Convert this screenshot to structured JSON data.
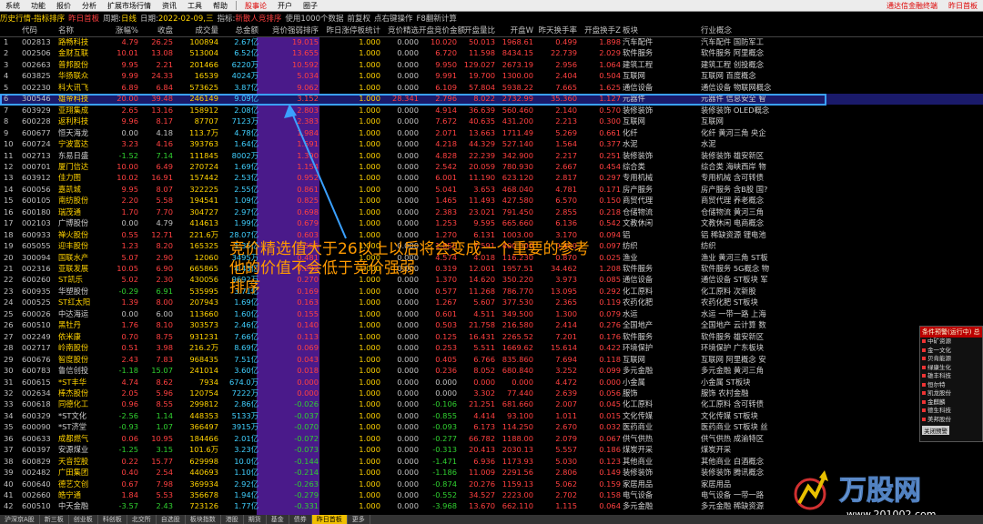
{
  "menu": {
    "items": [
      "系统",
      "功能",
      "报价",
      "分析",
      "扩展市场行情",
      "资讯",
      "工具",
      "帮助"
    ],
    "mid_items": [
      "股事论",
      "开户",
      "圈子"
    ],
    "right_items": [
      "通达信金融终端",
      "昨日首板"
    ]
  },
  "titlebar": {
    "tag": "历史行情-指标排序",
    "block": "昨日首板",
    "period_label": "周期:",
    "period": "日线",
    "date_label": "日期:",
    "date": "2022-02-09,三",
    "indicator_label": "指标:",
    "indicator": "新散人竞排序",
    "use_label": "使用1000个数据",
    "prev_label": "前复权",
    "hint": "点右键操作",
    "f8": "F8翻新计算"
  },
  "columns": [
    "",
    "代码",
    "名称",
    "涨幅%",
    "收盘",
    "成交量",
    "总金额",
    "竞价强弱排序",
    "昨日涨停板统计",
    "竞价精选",
    "开盘竞价金额",
    "开盘量比",
    "开盘W",
    "昨天换手率",
    "开盘换手Z",
    "板块",
    "行业概念"
  ],
  "rows": [
    [
      "1",
      "002813",
      "路畅科技",
      "4.79",
      "26.25",
      "100894",
      "2.67亿",
      "19.015",
      "1.000",
      "0.000",
      "10.020",
      "50.013",
      "1968.61",
      "0.499",
      "1.898",
      "汽车配件",
      "汽车配件  国防军工"
    ],
    [
      "2",
      "002506",
      "金财互联",
      "10.01",
      "13.08",
      "513004",
      "6.52亿",
      "13.655",
      "1.000",
      "0.000",
      "6.720",
      "11.598",
      "8434.15",
      "22.739",
      "2.029",
      "软件服务",
      "软件服务  阿里概念"
    ],
    [
      "3",
      "002663",
      "普邦股份",
      "9.95",
      "2.21",
      "201466",
      "6220万",
      "10.592",
      "1.000",
      "0.000",
      "9.950",
      "129.027",
      "2673.19",
      "2.956",
      "1.064",
      "建筑工程",
      "建筑工程  创投概念"
    ],
    [
      "4",
      "603825",
      "华扬联众",
      "9.99",
      "24.33",
      "16539",
      "4024万",
      "5.034",
      "1.000",
      "0.000",
      "9.991",
      "19.700",
      "1300.00",
      "2.404",
      "0.504",
      "互联网",
      "互联网  百度概念"
    ],
    [
      "5",
      "002230",
      "科大讯飞",
      "6.89",
      "6.84",
      "573625",
      "3.87亿",
      "9.062",
      "1.000",
      "0.000",
      "6.109",
      "57.804",
      "5938.22",
      "7.665",
      "1.625",
      "通信设备",
      "通信设备  物联网概念"
    ],
    [
      "6",
      "300546",
      "雄帝科技",
      "20.00",
      "39.48",
      "246149",
      "9.09亿",
      "3.152",
      "1.000",
      "28.341",
      "2.796",
      "8.022",
      "2732.99",
      "35.360",
      "1.127",
      "元器件",
      "元器件  信息安全 智"
    ],
    [
      "7",
      "603929",
      "亚翔集成",
      "2.65",
      "13.16",
      "158912",
      "2.08亿",
      "2.803",
      "1.000",
      "0.000",
      "4.914",
      "36.639",
      "560.460",
      "2.140",
      "0.570",
      "装修装饰",
      "装修装饰  OLED概念"
    ],
    [
      "8",
      "600228",
      "返利科技",
      "9.96",
      "8.17",
      "87707",
      "7123万",
      "2.383",
      "1.000",
      "0.000",
      "7.672",
      "40.635",
      "431.200",
      "2.213",
      "0.300",
      "互联网",
      "互联网"
    ],
    [
      "9",
      "600677",
      "恒天海龙",
      "0.00",
      "4.18",
      "113.7万",
      "4.78亿",
      "1.984",
      "1.000",
      "0.000",
      "2.071",
      "13.663",
      "1711.49",
      "5.269",
      "0.661",
      "化纤",
      "化纤  黄河三角 央企"
    ],
    [
      "10",
      "600724",
      "宁波富达",
      "3.23",
      "4.16",
      "393763",
      "1.64亿",
      "1.591",
      "1.000",
      "0.000",
      "4.218",
      "44.329",
      "527.140",
      "1.564",
      "0.377",
      "水泥",
      "水泥"
    ],
    [
      "11",
      "002713",
      "东易日盛",
      "-1.52",
      "7.14",
      "111845",
      "8002万",
      "1.390",
      "1.000",
      "0.000",
      "4.828",
      "22.239",
      "342.900",
      "2.217",
      "0.251",
      "装修装饰",
      "装修装饰  雄安新区"
    ],
    [
      "12",
      "000701",
      "厦门信达",
      "10.00",
      "6.49",
      "270724",
      "1.69亿",
      "1.154",
      "1.000",
      "0.000",
      "2.542",
      "20.059",
      "780.930",
      "2.667",
      "0.454",
      "综合类",
      "综合类  海峡西岸 物"
    ],
    [
      "13",
      "603912",
      "佳力图",
      "10.02",
      "16.91",
      "157442",
      "2.53亿",
      "0.952",
      "1.000",
      "0.000",
      "6.001",
      "11.190",
      "623.120",
      "2.817",
      "0.297",
      "专用机械",
      "专用机械  含可转债"
    ],
    [
      "14",
      "600056",
      "嘉凯城",
      "9.95",
      "8.07",
      "322225",
      "2.55亿",
      "0.861",
      "1.000",
      "0.000",
      "5.041",
      "3.653",
      "468.040",
      "4.781",
      "0.171",
      "房产服务",
      "房产服务  含B股 国?"
    ],
    [
      "15",
      "600105",
      "南纺股份",
      "2.20",
      "5.58",
      "194541",
      "1.09亿",
      "0.825",
      "1.000",
      "0.000",
      "1.465",
      "11.493",
      "427.580",
      "6.570",
      "0.150",
      "商贸代理",
      "商贸代理  养老概念"
    ],
    [
      "16",
      "600180",
      "瑞茂通",
      "1.70",
      "7.70",
      "304727",
      "2.97亿",
      "0.698",
      "1.000",
      "0.000",
      "2.383",
      "23.021",
      "791.450",
      "2.855",
      "0.218",
      "仓储物流",
      "仓储物流  黄河三角"
    ],
    [
      "17",
      "002103",
      "广博股份",
      "0.00",
      "4.79",
      "414613",
      "1.99亿",
      "0.679",
      "1.000",
      "0.000",
      "1.253",
      "9.595",
      "665.660",
      "6.136",
      "0.542",
      "文教休闲",
      "文教休闲  电商概念"
    ],
    [
      "18",
      "600933",
      "禅火股份",
      "0.55",
      "12.71",
      "221.6万",
      "28.07亿",
      "0.603",
      "1.000",
      "0.000",
      "1.270",
      "6.131",
      "1003.00",
      "3.170",
      "0.094",
      "铝",
      "铝  稀缺资源 锂电池"
    ],
    [
      "19",
      "605055",
      "迎丰股份",
      "1.23",
      "8.20",
      "165325",
      "1.35亿",
      "0.555",
      "1.000",
      "0.000",
      "1.856",
      "7.591",
      "400.000",
      "0.480",
      "0.097",
      "纺织",
      "纺织"
    ],
    [
      "20",
      "300094",
      "国联水产",
      "5.07",
      "2.90",
      "12060",
      "3495万",
      "0.481",
      "1.000",
      "0.000",
      "4.574",
      "4.018",
      "116.230",
      "0.870",
      "0.025",
      "渔业",
      "渔业  黄河三角 ST板"
    ],
    [
      "21",
      "002316",
      "亚联发展",
      "10.05",
      "6.90",
      "665865",
      "4.43亿",
      "0.292",
      "1.000",
      "0.000",
      "0.319",
      "12.001",
      "1957.51",
      "34.462",
      "1.208",
      "软件服务",
      "软件服务  5G概念 物"
    ],
    [
      "22",
      "600260",
      "ST凯乐",
      "5.02",
      "2.30",
      "430056",
      "9692万",
      "0.270",
      "1.000",
      "0.000",
      "1.370",
      "14.620",
      "350.220",
      "3.973",
      "0.085",
      "通信设备",
      "通信设备  ST板块 军"
    ],
    [
      "23",
      "600935",
      "华塑股份",
      "-0.29",
      "6.91",
      "535995",
      "3.71亿",
      "0.169",
      "1.000",
      "0.000",
      "0.577",
      "11.268",
      "786.770",
      "13.095",
      "0.292",
      "化工原料",
      "化工原料  次新股"
    ],
    [
      "24",
      "000525",
      "ST红太阳",
      "1.39",
      "8.00",
      "207943",
      "1.69亿",
      "0.163",
      "1.000",
      "0.000",
      "1.267",
      "5.607",
      "377.530",
      "2.365",
      "0.119",
      "农药化肥",
      "农药化肥  ST板块"
    ],
    [
      "25",
      "600026",
      "中达海运",
      "0.00",
      "6.00",
      "113660",
      "1.60亿",
      "0.155",
      "1.000",
      "0.000",
      "0.601",
      "4.511",
      "349.500",
      "1.300",
      "0.079",
      "水运",
      "水运  一带一路 上海"
    ],
    [
      "26",
      "600510",
      "黑牡丹",
      "1.76",
      "8.10",
      "303573",
      "2.46亿",
      "0.140",
      "1.000",
      "0.000",
      "0.503",
      "21.758",
      "216.580",
      "2.414",
      "0.276",
      "全国地产",
      "全国地产  云计算 数"
    ],
    [
      "27",
      "002249",
      "依米康",
      "0.70",
      "8.75",
      "931231",
      "7.66亿",
      "0.113",
      "1.000",
      "0.000",
      "0.125",
      "16.431",
      "2265.52",
      "7.201",
      "0.176",
      "软件服务",
      "软件服务  雄安新区"
    ],
    [
      "28",
      "002717",
      "岭南股份",
      "0.51",
      "3.98",
      "216.2万",
      "8.69亿",
      "0.069",
      "1.000",
      "0.000",
      "0.253",
      "5.511",
      "1669.62",
      "15.614",
      "0.422",
      "环境保护",
      "环境保护  广东板块"
    ],
    [
      "29",
      "600676",
      "智度股份",
      "2.43",
      "7.83",
      "968435",
      "7.51亿",
      "0.043",
      "1.000",
      "0.000",
      "0.405",
      "6.766",
      "835.860",
      "7.694",
      "0.118",
      "互联网",
      "互联网  阿里概念 安"
    ],
    [
      "30",
      "600783",
      "鲁信创投",
      "-1.18",
      "15.07",
      "241014",
      "3.60亿",
      "0.018",
      "1.000",
      "0.000",
      "0.236",
      "8.052",
      "680.840",
      "3.252",
      "0.099",
      "多元金融",
      "多元金融  黄河三角"
    ],
    [
      "31",
      "600615",
      "*ST丰华",
      "4.74",
      "8.62",
      "7934",
      "674.0万",
      "0.000",
      "1.000",
      "0.000",
      "0.000",
      "0.000",
      "0.000",
      "4.472",
      "0.000",
      "小金属",
      "小金属  ST板块"
    ],
    [
      "32",
      "002634",
      "棒杰股份",
      "2.05",
      "5.96",
      "120754",
      "7222万",
      "0.000",
      "1.000",
      "0.000",
      "0.000",
      "3.302",
      "77.440",
      "2.639",
      "0.056",
      "服饰",
      "服饰  农村金融"
    ],
    [
      "33",
      "600618",
      "同德化工",
      "0.96",
      "8.55",
      "299812",
      "2.86亿",
      "-0.026",
      "1.000",
      "0.000",
      "-0.106",
      "21.251",
      "681.660",
      "2.007",
      "0.045",
      "化工原料",
      "化工原料  含可转债"
    ],
    [
      "34",
      "600329",
      "*ST文化",
      "-2.56",
      "1.14",
      "448353",
      "5133万",
      "-0.037",
      "1.000",
      "0.000",
      "-0.855",
      "4.414",
      "93.100",
      "1.011",
      "0.015",
      "文化传媒",
      "文化传媒  ST板块"
    ],
    [
      "35",
      "600090",
      "*ST济堂",
      "-0.93",
      "1.07",
      "366497",
      "3915万",
      "-0.070",
      "1.000",
      "0.000",
      "-0.093",
      "6.173",
      "114.250",
      "2.670",
      "0.032",
      "医药商业",
      "医药商业  ST板块 丝"
    ],
    [
      "36",
      "600633",
      "成都燃气",
      "0.06",
      "10.95",
      "184466",
      "2.01亿",
      "-0.072",
      "1.000",
      "0.000",
      "-0.277",
      "66.782",
      "1188.00",
      "2.079",
      "0.067",
      "供气供热",
      "供气供热  成渝特区"
    ],
    [
      "37",
      "600397",
      "安源煤业",
      "-1.25",
      "3.15",
      "101.6万",
      "3.23亿",
      "-0.073",
      "1.000",
      "0.000",
      "-0.313",
      "20.413",
      "2030.13",
      "5.557",
      "0.186",
      "煤炭开采",
      "煤炭开采"
    ],
    [
      "38",
      "600829",
      "天音控股",
      "0.22",
      "15.77",
      "629998",
      "10.0亿",
      "-0.144",
      "1.000",
      "0.000",
      "-1.471",
      "6.936",
      "1173.93",
      "5.030",
      "0.123",
      "其他商业",
      "其他商业  白酒概念"
    ],
    [
      "39",
      "002482",
      "广田集团",
      "0.40",
      "2.54",
      "440693",
      "1.10亿",
      "-0.214",
      "1.000",
      "0.000",
      "-1.186",
      "11.009",
      "2291.56",
      "2.806",
      "0.149",
      "装修装饰",
      "装修装饰  腾讯概念"
    ],
    [
      "40",
      "600640",
      "德艺文创",
      "0.67",
      "7.98",
      "369934",
      "2.92亿",
      "-0.263",
      "1.000",
      "0.000",
      "-0.874",
      "20.276",
      "1159.13",
      "5.062",
      "0.159",
      "家居用品",
      "家居用品"
    ],
    [
      "41",
      "002660",
      "皓宁通",
      "1.84",
      "5.53",
      "356678",
      "1.94亿",
      "-0.279",
      "1.000",
      "0.000",
      "-0.552",
      "34.527",
      "2223.00",
      "2.702",
      "0.158",
      "电气设备",
      "电气设备  一带一路"
    ],
    [
      "42",
      "600510",
      "中天金融",
      "-3.57",
      "2.43",
      "723126",
      "1.77亿",
      "-0.331",
      "1.000",
      "0.000",
      "-3.968",
      "13.670",
      "662.110",
      "1.115",
      "0.064",
      "多元金融",
      "多元金融  稀缺资源"
    ]
  ],
  "annotation": {
    "line1": "竞价精选值大于26以上以后将会变成一个重要的参考",
    "line2": "他的价值不会低于竞价强弱",
    "line3": "排序"
  },
  "side_panel": {
    "title": "条件预警(运行中) 总",
    "items": [
      "中矿资源",
      "金一文化",
      "贝肯能源",
      "绿康生化",
      "雄丰科技",
      "恒尔特",
      "凯龙股份",
      "金麒麟",
      "德生科技",
      "美邦股份"
    ],
    "button": "关闭预警"
  },
  "watermark": {
    "brand": "万股网",
    "url": "www.201002.com"
  },
  "statusbar": [
    "沪深京A股",
    "新三板",
    "创业板",
    "科创板",
    "北交所",
    "自选股",
    "板块指数",
    "港股",
    "期货",
    "基金",
    "债券",
    "昨日首板",
    "更多"
  ],
  "colors": {
    "up": "#ff4040",
    "down": "#30d030",
    "flat": "#c0c0c0",
    "code": "#c0c0c0",
    "name_yellow": "#ffd200",
    "purple_col": "#4a1a8a",
    "highlight": "#3aa0ff",
    "annotation": "#ff9a00"
  }
}
